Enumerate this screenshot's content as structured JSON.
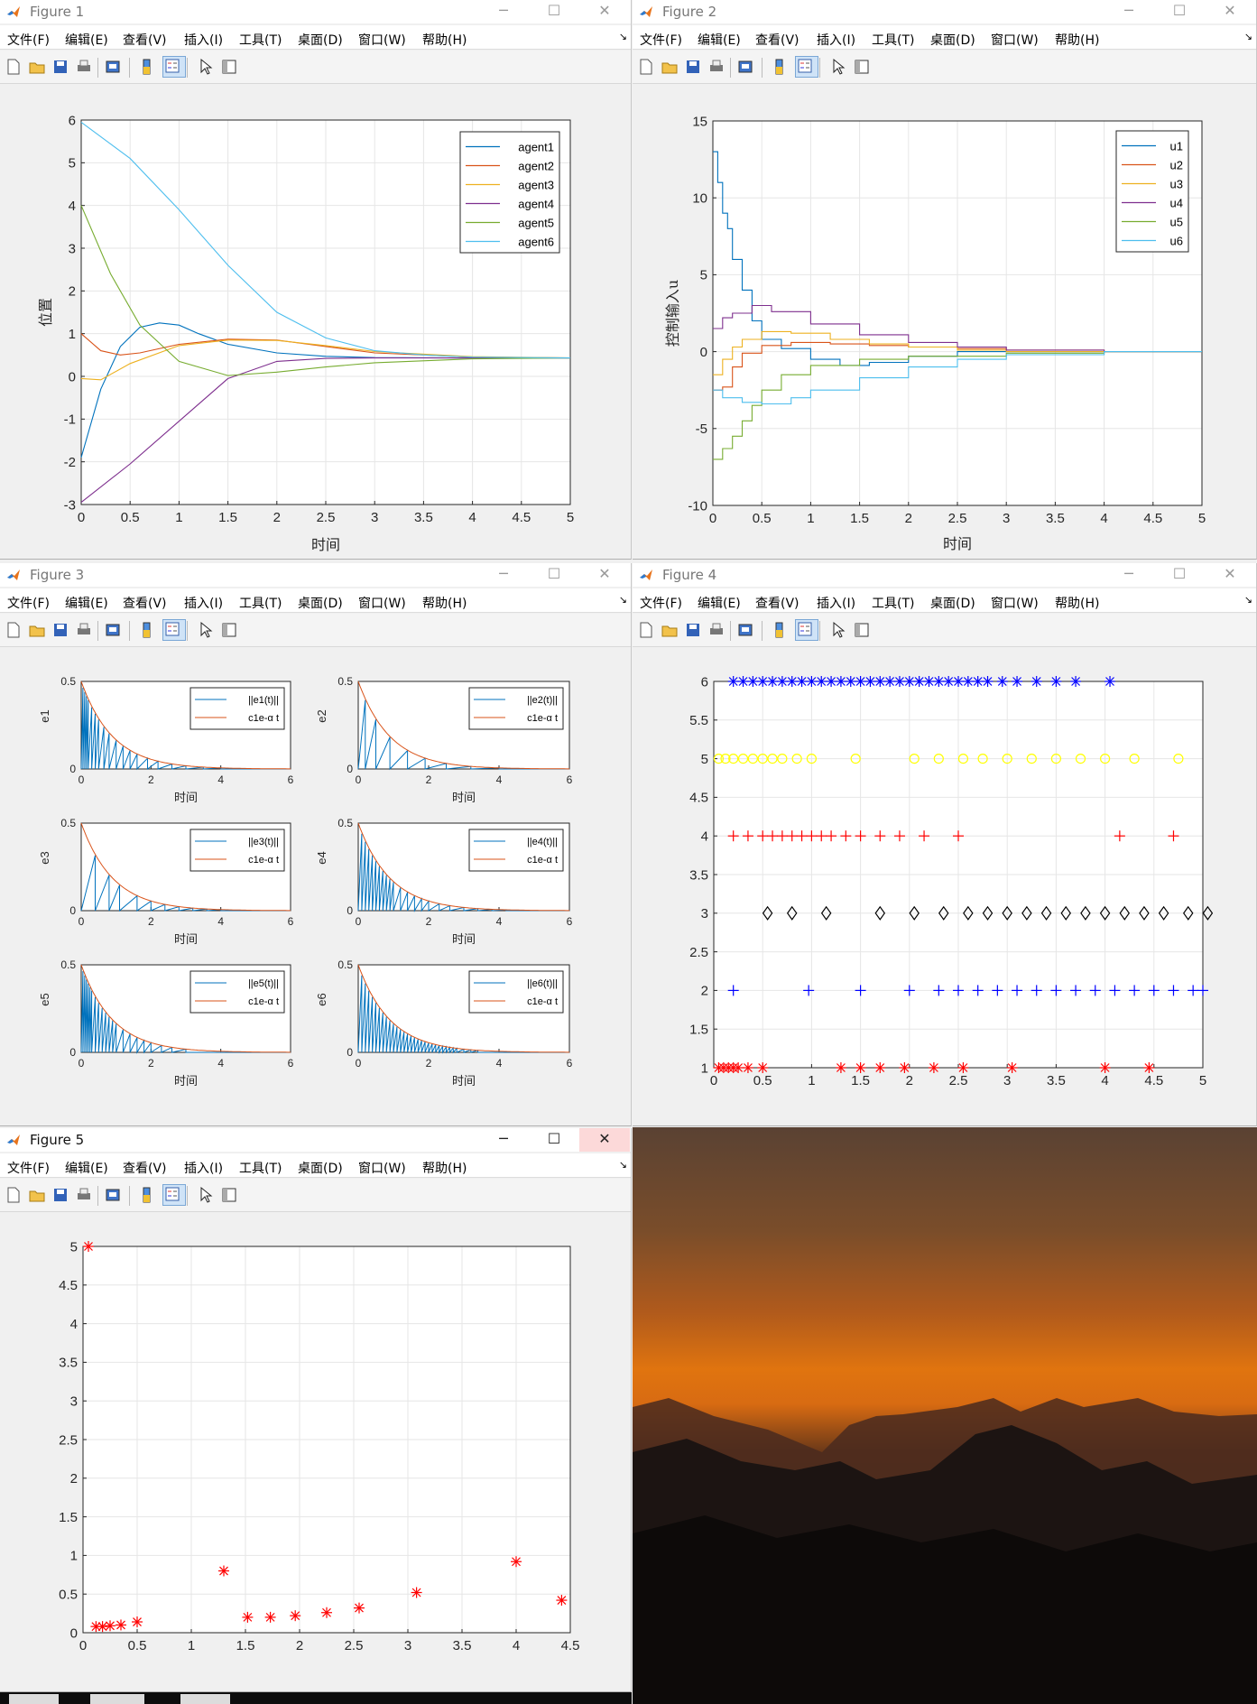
{
  "menus": [
    "文件(F)",
    "编辑(E)",
    "查看(V)",
    "插入(I)",
    "工具(T)",
    "桌面(D)",
    "窗口(W)",
    "帮助(H)"
  ],
  "window_controls": {
    "minimize": "─",
    "maximize": "☐",
    "close": "✕",
    "menu_arrow": "↘"
  },
  "windows": [
    {
      "title": "Figure 1",
      "active": false
    },
    {
      "title": "Figure 2",
      "active": false
    },
    {
      "title": "Figure 3",
      "active": false
    },
    {
      "title": "Figure 4",
      "active": false
    },
    {
      "title": "Figure 5",
      "active": true
    }
  ],
  "toolbar_icons": [
    "new-figure-icon",
    "open-file-icon",
    "save-icon",
    "print-icon",
    "print-preview-icon",
    "colorbar-icon",
    "legend-icon",
    "edit-plot-arrow-icon",
    "property-inspector-icon"
  ],
  "colors": {
    "c1": "#0072bd",
    "c2": "#d95319",
    "c3": "#edb120",
    "c4": "#7e2f8e",
    "c5": "#77ac30",
    "c6": "#4dbeee"
  },
  "chart_data": [
    {
      "type": "line",
      "window": "Figure 1",
      "xlabel": "时间",
      "ylabel": "位置",
      "xlim": [
        0,
        5
      ],
      "ylim": [
        -3,
        6
      ],
      "xticks": [
        0,
        0.5,
        1,
        1.5,
        2,
        2.5,
        3,
        3.5,
        4,
        4.5,
        5
      ],
      "yticks": [
        -3,
        -2,
        -1,
        0,
        1,
        2,
        3,
        4,
        5,
        6
      ],
      "grid": true,
      "legend_position": "top-right",
      "series": [
        {
          "name": "agent1",
          "color": "#0072bd",
          "x": [
            0,
            0.2,
            0.4,
            0.6,
            0.8,
            1,
            1.2,
            1.5,
            2,
            2.5,
            3,
            4,
            5
          ],
          "y": [
            -1.9,
            -0.3,
            0.7,
            1.15,
            1.25,
            1.2,
            1.0,
            0.75,
            0.55,
            0.47,
            0.44,
            0.43,
            0.43
          ]
        },
        {
          "name": "agent2",
          "color": "#d95319",
          "x": [
            0,
            0.2,
            0.4,
            0.6,
            1,
            1.5,
            2,
            2.5,
            3,
            4,
            5
          ],
          "y": [
            1.0,
            0.6,
            0.5,
            0.55,
            0.75,
            0.87,
            0.85,
            0.7,
            0.55,
            0.45,
            0.43
          ]
        },
        {
          "name": "agent3",
          "color": "#edb120",
          "x": [
            0,
            0.2,
            0.5,
            1,
            1.5,
            2,
            2.5,
            3,
            4,
            5
          ],
          "y": [
            -0.05,
            -0.08,
            0.3,
            0.72,
            0.85,
            0.84,
            0.72,
            0.58,
            0.46,
            0.43
          ]
        },
        {
          "name": "agent4",
          "color": "#7e2f8e",
          "x": [
            0,
            0.5,
            1,
            1.5,
            2,
            2.5,
            3,
            4,
            5
          ],
          "y": [
            -2.95,
            -2.05,
            -1.05,
            -0.05,
            0.35,
            0.42,
            0.43,
            0.43,
            0.43
          ]
        },
        {
          "name": "agent5",
          "color": "#77ac30",
          "x": [
            0,
            0.3,
            0.6,
            1,
            1.5,
            2,
            2.5,
            3,
            4,
            5
          ],
          "y": [
            4.0,
            2.4,
            1.2,
            0.35,
            0.02,
            0.1,
            0.22,
            0.32,
            0.41,
            0.43
          ]
        },
        {
          "name": "agent6",
          "color": "#4dbeee",
          "x": [
            0,
            0.5,
            1,
            1.5,
            2,
            2.5,
            3,
            3.5,
            4,
            5
          ],
          "y": [
            5.95,
            5.1,
            3.9,
            2.6,
            1.5,
            0.9,
            0.6,
            0.5,
            0.45,
            0.43
          ]
        }
      ]
    },
    {
      "type": "line",
      "window": "Figure 2",
      "xlabel": "时间",
      "ylabel": "控制输入u",
      "xlim": [
        0,
        5
      ],
      "ylim": [
        -10,
        15
      ],
      "xticks": [
        0,
        0.5,
        1,
        1.5,
        2,
        2.5,
        3,
        3.5,
        4,
        4.5,
        5
      ],
      "yticks": [
        -10,
        -5,
        0,
        5,
        10,
        15
      ],
      "grid": true,
      "legend_position": "top-right",
      "series": [
        {
          "name": "u1",
          "color": "#0072bd",
          "x": [
            0,
            0.05,
            0.1,
            0.15,
            0.2,
            0.3,
            0.4,
            0.5,
            0.7,
            1,
            1.3,
            1.6,
            2,
            2.5,
            3,
            4,
            5
          ],
          "y": [
            13,
            11,
            9,
            8,
            6,
            4,
            2,
            0.8,
            0.2,
            -0.5,
            -0.9,
            -0.7,
            -0.3,
            0.0,
            0.0,
            0.0,
            0.0
          ]
        },
        {
          "name": "u2",
          "color": "#d95319",
          "x": [
            0,
            0.1,
            0.2,
            0.3,
            0.5,
            0.8,
            1.2,
            1.6,
            2,
            2.5,
            3,
            4,
            5
          ],
          "y": [
            -2.5,
            -2.3,
            -1.0,
            -0.1,
            0.4,
            0.6,
            0.5,
            0.4,
            0.3,
            0.2,
            0.1,
            0.0,
            0.0
          ]
        },
        {
          "name": "u3",
          "color": "#edb120",
          "x": [
            0,
            0.1,
            0.2,
            0.3,
            0.5,
            0.8,
            1.2,
            1.6,
            2,
            2.5,
            3,
            4,
            5
          ],
          "y": [
            -1.5,
            -0.5,
            0.3,
            0.8,
            1.3,
            1.2,
            0.8,
            0.5,
            0.3,
            0.1,
            0.0,
            0.0,
            0.0
          ]
        },
        {
          "name": "u4",
          "color": "#7e2f8e",
          "x": [
            0,
            0.1,
            0.2,
            0.4,
            0.6,
            1,
            1.5,
            2,
            2.5,
            3,
            4,
            5
          ],
          "y": [
            1.5,
            2.2,
            2.5,
            3.0,
            2.6,
            1.8,
            1.1,
            0.6,
            0.3,
            0.1,
            0.0,
            0.0
          ]
        },
        {
          "name": "u5",
          "color": "#77ac30",
          "x": [
            0,
            0.1,
            0.2,
            0.3,
            0.4,
            0.5,
            0.7,
            1,
            1.5,
            2,
            3,
            4,
            5
          ],
          "y": [
            -7,
            -6.3,
            -5.5,
            -4.5,
            -3.5,
            -2.5,
            -1.5,
            -0.9,
            -0.5,
            -0.3,
            -0.1,
            0.0,
            0.0
          ]
        },
        {
          "name": "u6",
          "color": "#4dbeee",
          "x": [
            0,
            0.1,
            0.3,
            0.5,
            0.8,
            1,
            1.5,
            2,
            2.5,
            3,
            4,
            5
          ],
          "y": [
            -2.5,
            -3.0,
            -3.3,
            -3.4,
            -3.0,
            -2.5,
            -1.7,
            -1.0,
            -0.5,
            -0.2,
            0.0,
            0.0
          ]
        }
      ]
    },
    {
      "type": "line",
      "window": "Figure 3",
      "subplots": [
        {
          "ylabel": "e1",
          "legend": [
            "||e1(t)||",
            "c1e-α t"
          ],
          "events": [
            0.05,
            0.1,
            0.15,
            0.2,
            0.3,
            0.4,
            0.5,
            0.65,
            0.8,
            1,
            1.2,
            1.4,
            1.6,
            1.9,
            2.2,
            2.6,
            3,
            3.5,
            4
          ]
        },
        {
          "ylabel": "e2",
          "legend": [
            "||e2(t)||",
            "c1e-α t"
          ],
          "events": [
            0.2,
            0.5,
            0.9,
            1.4,
            1.9,
            2.5,
            3.2,
            4
          ]
        },
        {
          "ylabel": "e3",
          "legend": [
            "||e3(t)||",
            "c1e-α t"
          ],
          "events": [
            0.4,
            0.8,
            1.1,
            1.6,
            2,
            2.4,
            2.8,
            3.2,
            3.6,
            4
          ]
        },
        {
          "ylabel": "e4",
          "legend": [
            "||e4(t)||",
            "c1e-α t"
          ],
          "events": [
            0.1,
            0.2,
            0.3,
            0.4,
            0.5,
            0.6,
            0.7,
            0.8,
            0.9,
            1,
            1.2,
            1.4,
            1.6,
            1.8,
            2,
            2.3,
            2.6,
            3,
            3.4,
            3.8,
            4.2
          ]
        },
        {
          "ylabel": "e5",
          "legend": [
            "||e5(t)||",
            "c1e-α t"
          ],
          "events": [
            0.05,
            0.1,
            0.15,
            0.2,
            0.25,
            0.3,
            0.4,
            0.5,
            0.6,
            0.7,
            0.8,
            0.9,
            1,
            1.2,
            1.4,
            1.6,
            1.8,
            2,
            2.3,
            2.6,
            3
          ]
        },
        {
          "ylabel": "e6",
          "legend": [
            "||e6(t)||",
            "c1e-α t"
          ],
          "events": [
            0.1,
            0.2,
            0.3,
            0.4,
            0.5,
            0.6,
            0.7,
            0.8,
            0.9,
            1,
            1.1,
            1.2,
            1.3,
            1.4,
            1.5,
            1.6,
            1.7,
            1.8,
            1.9,
            2,
            2.1,
            2.2,
            2.3,
            2.4,
            2.5,
            2.6,
            2.7,
            2.8,
            3,
            3.2,
            3.4
          ]
        }
      ],
      "xlabel": "时间",
      "xlim": [
        0,
        6
      ],
      "ylim": [
        0,
        0.5
      ],
      "xticks": [
        0,
        2,
        4,
        6
      ],
      "yticks": [
        0,
        0.5
      ],
      "decay_c1": 0.5,
      "decay_alpha": 1.1
    },
    {
      "type": "scatter",
      "window": "Figure 4",
      "xlim": [
        0,
        5
      ],
      "ylim": [
        1,
        6
      ],
      "xticks": [
        0,
        0.5,
        1,
        1.5,
        2,
        2.5,
        3,
        3.5,
        4,
        4.5,
        5
      ],
      "yticks": [
        1,
        1.5,
        2,
        2.5,
        3,
        3.5,
        4,
        4.5,
        5,
        5.5,
        6
      ],
      "grid": true,
      "series": [
        {
          "y": 1,
          "marker": "*",
          "color": "#ff0000",
          "x": [
            0.05,
            0.1,
            0.15,
            0.2,
            0.25,
            0.35,
            0.5,
            1.3,
            1.5,
            1.7,
            1.95,
            2.25,
            2.55,
            3.05,
            4,
            4.45
          ]
        },
        {
          "y": 2,
          "marker": "+",
          "color": "#0000ff",
          "x": [
            0.2,
            0.97,
            1.5,
            2,
            2.3,
            2.5,
            2.7,
            2.9,
            3.1,
            3.3,
            3.5,
            3.7,
            3.9,
            4.1,
            4.3,
            4.5,
            4.7,
            4.9,
            5
          ]
        },
        {
          "y": 3,
          "marker": "d",
          "color": "#000000",
          "x": [
            0.55,
            0.8,
            1.15,
            1.7,
            2.05,
            2.35,
            2.6,
            2.8,
            3,
            3.2,
            3.4,
            3.6,
            3.8,
            4,
            4.2,
            4.4,
            4.6,
            4.85,
            5.05
          ]
        },
        {
          "y": 4,
          "marker": "+",
          "color": "#ff0000",
          "x": [
            0.2,
            0.35,
            0.5,
            0.6,
            0.7,
            0.8,
            0.9,
            1,
            1.1,
            1.2,
            1.35,
            1.5,
            1.7,
            1.9,
            2.15,
            2.5,
            4.15,
            4.7
          ]
        },
        {
          "y": 5,
          "marker": "o",
          "color": "#ffff00",
          "x": [
            0.05,
            0.12,
            0.2,
            0.3,
            0.4,
            0.5,
            0.6,
            0.7,
            0.85,
            1,
            1.45,
            2.05,
            2.3,
            2.55,
            2.75,
            3,
            3.25,
            3.5,
            3.75,
            4,
            4.3,
            4.75
          ]
        },
        {
          "y": 6,
          "marker": "*",
          "color": "#0000ff",
          "x": [
            0.2,
            0.3,
            0.4,
            0.5,
            0.6,
            0.7,
            0.8,
            0.9,
            1,
            1.1,
            1.2,
            1.3,
            1.4,
            1.5,
            1.6,
            1.7,
            1.8,
            1.9,
            2,
            2.1,
            2.2,
            2.3,
            2.4,
            2.5,
            2.6,
            2.7,
            2.8,
            2.95,
            3.1,
            3.3,
            3.5,
            3.7,
            4.05
          ]
        }
      ]
    },
    {
      "type": "scatter",
      "window": "Figure 5",
      "xlim": [
        0,
        4.5
      ],
      "ylim": [
        0,
        5
      ],
      "xticks": [
        0,
        0.5,
        1,
        1.5,
        2,
        2.5,
        3,
        3.5,
        4,
        4.5
      ],
      "yticks": [
        0,
        0.5,
        1,
        1.5,
        2,
        2.5,
        3,
        3.5,
        4,
        4.5,
        5
      ],
      "grid": true,
      "series": [
        {
          "marker": "*",
          "color": "#ff0000",
          "x": [
            0.05,
            0.12,
            0.18,
            0.25,
            0.35,
            0.5,
            1.3,
            1.52,
            1.73,
            1.96,
            2.25,
            2.55,
            3.08,
            4,
            4.42
          ],
          "y": [
            5,
            0.08,
            0.08,
            0.09,
            0.1,
            0.14,
            0.8,
            0.2,
            0.2,
            0.22,
            0.26,
            0.32,
            0.52,
            0.92,
            0.42
          ]
        }
      ]
    }
  ]
}
